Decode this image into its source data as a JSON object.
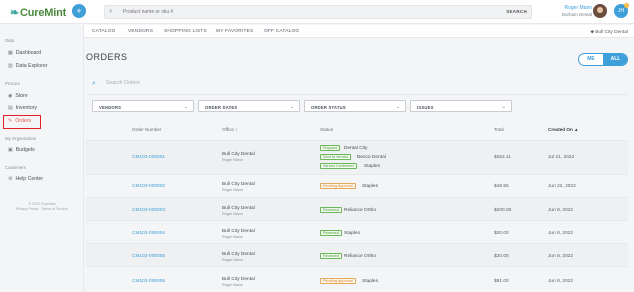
{
  "brand": {
    "name": "CureMint",
    "accent": "#3f9fd8"
  },
  "header": {
    "plus_label": "+",
    "search_placeholder": "Product name or sku #",
    "search_button": "SEARCH",
    "user_name": "Roger Mann",
    "user_org": "Durham Dental",
    "initials": "JH",
    "notification_count": "4"
  },
  "subnav": {
    "items": [
      "CATALOG",
      "VENDORS",
      "SHOPPING LISTS",
      "MY FAVORITES",
      "OFF CATALOG"
    ],
    "location": "Bull City Dental"
  },
  "sidebar": {
    "sections": [
      {
        "title": "Data",
        "items": [
          {
            "label": "Dashboard",
            "icon": "grid-icon"
          },
          {
            "label": "Data Explorer",
            "icon": "chart-icon"
          }
        ]
      },
      {
        "title": "Procure",
        "items": [
          {
            "label": "Store",
            "icon": "store-icon"
          },
          {
            "label": "Inventory",
            "icon": "inventory-icon"
          },
          {
            "label": "Orders",
            "icon": "orders-icon",
            "active": true
          }
        ]
      },
      {
        "title": "My Organization",
        "items": [
          {
            "label": "Budgets",
            "icon": "budget-icon"
          }
        ]
      },
      {
        "title": "Customers",
        "items": [
          {
            "label": "Help Center",
            "icon": "help-icon"
          }
        ]
      }
    ],
    "footer_line1": "© 2022 CureMint",
    "footer_line2": "Privacy Policy  ·  Terms of Service"
  },
  "main": {
    "title": "ORDERS",
    "toggle": {
      "me": "ME",
      "all": "ALL"
    },
    "search_placeholder": "Search Orders",
    "filters": [
      "VENDORS",
      "ORDER DATES",
      "ORDER STATUS",
      "ISSUES"
    ],
    "columns": [
      "Order Number",
      "Office  ↕",
      "Status",
      "Total",
      "Created On  ▲"
    ],
    "rows": [
      {
        "order": "CM103-000001",
        "office": "Bull City Dental",
        "user": "Roger Mann",
        "statuses": [
          {
            "label": "Shipped",
            "color": "green",
            "vendor": "Dental City"
          },
          {
            "label": "Sent to Vendor",
            "color": "green",
            "vendor": "Benco Dental"
          },
          {
            "label": "Vendor Confirmed",
            "color": "green",
            "vendor": "Staples"
          }
        ],
        "total": "$262.11",
        "created": "Jul 21, 2022"
      },
      {
        "order": "CM103-000002",
        "office": "Bull City Dental",
        "user": "Roger Mann",
        "statuses": [
          {
            "label": "Pending Approval",
            "color": "orange",
            "vendor": "Staples"
          }
        ],
        "total": "$48.55",
        "created": "Jun 22, 2022"
      },
      {
        "order": "CM103-000003",
        "office": "Bull City Dental",
        "user": "Roger Mann",
        "statuses": [
          {
            "label": "Received",
            "color": "green",
            "vendor": "Reliance Ortho"
          }
        ],
        "total": "$200.00",
        "created": "Jun 8, 2022"
      },
      {
        "order": "CM103-000004",
        "office": "Bull City Dental",
        "user": "Roger Mann",
        "statuses": [
          {
            "label": "Received",
            "color": "green",
            "vendor": "Staples"
          }
        ],
        "total": "$20.00",
        "created": "Jun 8, 2022"
      },
      {
        "order": "CM103-000005",
        "office": "Bull City Dental",
        "user": "Roger Mann",
        "statuses": [
          {
            "label": "Received",
            "color": "green",
            "vendor": "Reliance Ortho"
          }
        ],
        "total": "$20.00",
        "created": "Jun 8, 2022"
      },
      {
        "order": "CM103-000006",
        "office": "Bull City Dental",
        "user": "Roger Mann",
        "statuses": [
          {
            "label": "Pending Approval",
            "color": "orange",
            "vendor": "Staples"
          }
        ],
        "total": "$81.00",
        "created": "Jun 8, 2022"
      }
    ]
  }
}
